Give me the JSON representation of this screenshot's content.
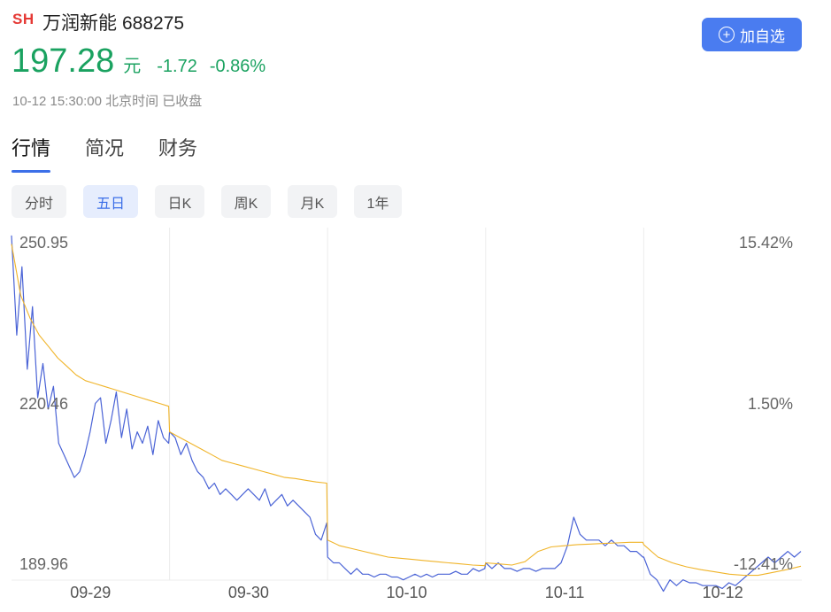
{
  "stock": {
    "market": "SH",
    "name": "万润新能",
    "code": "688275",
    "price": "197.28",
    "unit": "元",
    "change": "-1.72",
    "change_pct": "-0.86%",
    "timestamp": "10-12 15:30:00 北京时间 已收盘"
  },
  "add_button": {
    "label": "加自选",
    "icon": "plus-circle-icon"
  },
  "tabs": [
    {
      "label": "行情",
      "active": true
    },
    {
      "label": "简况",
      "active": false
    },
    {
      "label": "财务",
      "active": false
    }
  ],
  "periods": [
    {
      "label": "分时",
      "active": false
    },
    {
      "label": "五日",
      "active": true
    },
    {
      "label": "日K",
      "active": false
    },
    {
      "label": "周K",
      "active": false
    },
    {
      "label": "月K",
      "active": false
    },
    {
      "label": "1年",
      "active": false
    }
  ],
  "colors": {
    "up_down_green": "#1aa260",
    "accent_blue": "#3c6fe8",
    "price_line": "#4a63d6",
    "avg_line": "#f0b429",
    "market_red": "#e53935"
  },
  "chart_data": {
    "type": "line",
    "title": "",
    "y_labels_left": [
      "250.95",
      "220.46",
      "189.96"
    ],
    "y_labels_right": [
      "15.42%",
      "1.50%",
      "-12.41%"
    ],
    "ylim": [
      189.96,
      250.95
    ],
    "x_days": [
      "09-29",
      "09-30",
      "10-10",
      "10-11",
      "10-12"
    ],
    "grid": true,
    "series": [
      {
        "values": [
          [
            250.5,
            233,
            245,
            227,
            238,
            222,
            228,
            220,
            224,
            214,
            212,
            210,
            208,
            209,
            212,
            216,
            221,
            222,
            214,
            218,
            223,
            215,
            220,
            213,
            216,
            214,
            217,
            212,
            218,
            215,
            214
          ],
          [
            216,
            215,
            212,
            214,
            211,
            209,
            208,
            206,
            207,
            205,
            206,
            205,
            204,
            205,
            206,
            205,
            204,
            206,
            203,
            204,
            205,
            203,
            204,
            203,
            202,
            201,
            198,
            197,
            200
          ],
          [
            194,
            193,
            193,
            192,
            191,
            192,
            191,
            191,
            190.5,
            191,
            191,
            190.5,
            190.5,
            190,
            190.5,
            191,
            190.5,
            191,
            190.5,
            191,
            191,
            191,
            191.5,
            191,
            191,
            192,
            191.5,
            192
          ],
          [
            193,
            192,
            193,
            192,
            192,
            191.5,
            192,
            192,
            191.5,
            192,
            192,
            192,
            193,
            196,
            201,
            198,
            197,
            197,
            197,
            196,
            197,
            196,
            196,
            195,
            195,
            194
          ],
          [
            194,
            191,
            190,
            188,
            190,
            189,
            190,
            189.5,
            189.5,
            189,
            189,
            189,
            188.5,
            189.5,
            189,
            190,
            191,
            192,
            193,
            194,
            193,
            194,
            195,
            194,
            195
          ]
        ]
      },
      {
        "values": [
          [
            249,
            240,
            236,
            233,
            231,
            229,
            227.5,
            226,
            225,
            224.5,
            224,
            223.5,
            223,
            222.5,
            222,
            221.5,
            221,
            220.5
          ],
          [
            216,
            215,
            214,
            213,
            212,
            211,
            210.5,
            210,
            209.5,
            209,
            208.5,
            208,
            207.8,
            207.5,
            207.2,
            207
          ],
          [
            197,
            196,
            195.5,
            195,
            194.5,
            194,
            193.8,
            193.6,
            193.4,
            193.2,
            193,
            192.8,
            192.6,
            192.5
          ],
          [
            193,
            192.8,
            192.6,
            193.2,
            195,
            195.8,
            196,
            196.2,
            196.3,
            196.4,
            196.5,
            196.6,
            196.6
          ],
          [
            196.2,
            194,
            193,
            192.3,
            191.8,
            191.4,
            191,
            190.8,
            190.8,
            191.3,
            191.8,
            192.4
          ]
        ]
      }
    ]
  }
}
